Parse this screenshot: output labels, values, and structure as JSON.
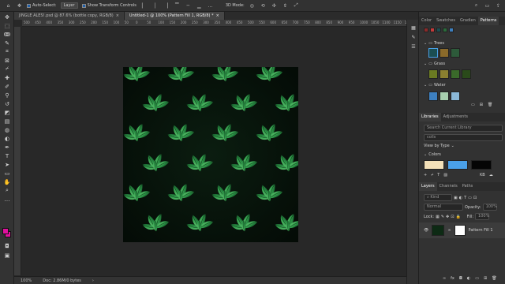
{
  "optbar": {
    "auto_select_label": "Auto-Select:",
    "auto_select_value": "Layer",
    "transform_label": "Show Transform Controls",
    "mode_3d": "3D Mode:"
  },
  "tabs": [
    {
      "label": "JINGLE ALES!.psd @ 87.6% (bottle copy, RGB/8)"
    },
    {
      "label": "Untitled-1 @ 100% (Pattern Fill 1, RGB/8) *"
    }
  ],
  "ruler_labels": [
    "500",
    "450",
    "400",
    "350",
    "300",
    "250",
    "200",
    "150",
    "100",
    "50",
    "0",
    "50",
    "100",
    "150",
    "200",
    "250",
    "300",
    "350",
    "400",
    "450",
    "500",
    "550",
    "600",
    "650",
    "700",
    "750",
    "800",
    "850",
    "900",
    "950",
    "1000",
    "1050",
    "1100",
    "1150",
    "1200"
  ],
  "status": {
    "zoom": "100%",
    "doc": "Doc: 2.86M/0 bytes"
  },
  "colors": {
    "foreground": "#e0119d",
    "background": "#e0119d"
  },
  "patterns_panel": {
    "tabs": [
      "Color",
      "Swatches",
      "Gradien",
      "Patterns"
    ],
    "groups": [
      {
        "name": "Trees",
        "swatches": [
          "#1b4e52",
          "#8a6a2a",
          "#2d5a3a"
        ]
      },
      {
        "name": "Grass",
        "swatches": [
          "#6a7a22",
          "#8a8030",
          "#3a6a2a",
          "#2a4a1a"
        ]
      },
      {
        "name": "Water",
        "swatches": [
          "#3d7fbf",
          "#a8d0b0",
          "#8ab8d8"
        ]
      }
    ]
  },
  "libraries_panel": {
    "tabs": [
      "Libraries",
      "Adjustments"
    ],
    "search_placeholder": "Search Current Library",
    "library": "colls",
    "view_by": "View by Type",
    "section": "Colors",
    "color_swatches": [
      "#f3e0b8",
      "#4aa0e8",
      "#050505"
    ],
    "size": "KB"
  },
  "layers_panel": {
    "tabs": [
      "Layers",
      "Channels",
      "Paths"
    ],
    "kind": "Kind",
    "blend": "Normal",
    "opacity_label": "Opacity:",
    "opacity": "100%",
    "lock_label": "Lock:",
    "fill_label": "Fill:",
    "fill": "100%",
    "layer_name": "Pattern Fill 1"
  },
  "right_icons": [
    "layers-icon",
    "brush-settings-icon",
    "history-icon",
    "properties-icon",
    "shapes-icon"
  ]
}
